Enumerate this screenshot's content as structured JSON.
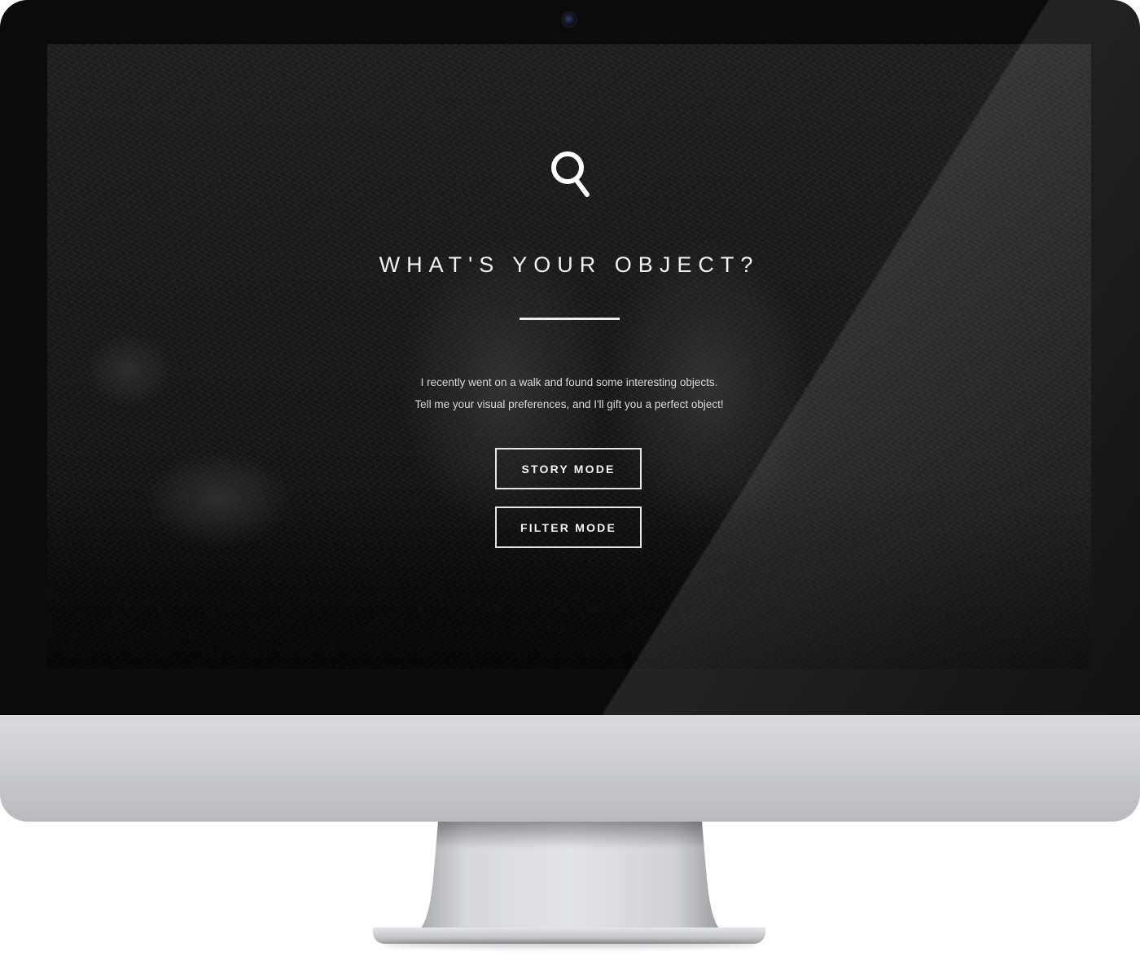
{
  "page": {
    "title": "WHAT'S YOUR OBJECT?",
    "intro_line_1": "I recently went on a walk and found some interesting objects.",
    "intro_line_2": "Tell me your visual preferences, and I'll gift you a perfect object!"
  },
  "buttons": {
    "story_mode": "STORY MODE",
    "filter_mode": "FILTER MODE"
  },
  "icons": {
    "logo": "magnifier-icon"
  },
  "colors": {
    "screen_bg": "#151516",
    "text": "#f2f2f2",
    "button_border": "#e6e6e6",
    "bezel": "#0b0b0c",
    "chin": "#c9cacd"
  }
}
